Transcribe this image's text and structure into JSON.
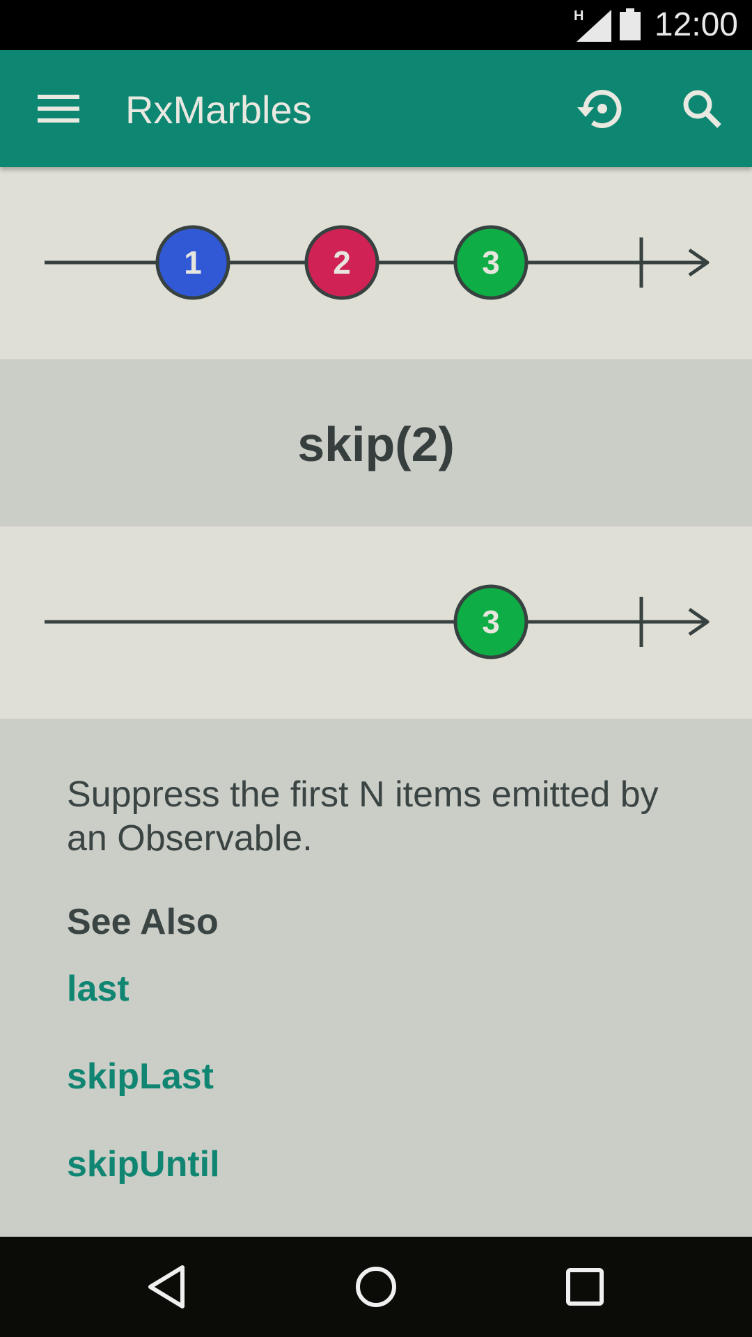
{
  "status_bar": {
    "time": "12:00",
    "network": "H"
  },
  "app_bar": {
    "title": "RxMarbles",
    "icons": {
      "menu": "menu-icon",
      "reset": "restore-icon",
      "search": "search-icon"
    }
  },
  "input_stream": {
    "marbles": [
      {
        "label": "1",
        "color": "#3159d6",
        "time": 1
      },
      {
        "label": "2",
        "color": "#d12255",
        "time": 2
      },
      {
        "label": "3",
        "color": "#0fad45",
        "time": 3
      }
    ],
    "completed": true
  },
  "operator": {
    "label": "skip(2)"
  },
  "output_stream": {
    "marbles": [
      {
        "label": "3",
        "color": "#0fad45",
        "time": 3
      }
    ],
    "completed": true
  },
  "description": {
    "text": "Suppress the first N items emitted by an Observable.",
    "see_also_heading": "See Also",
    "links": [
      "last",
      "skipLast",
      "skipUntil"
    ]
  },
  "colors": {
    "primary": "#0d8672",
    "link": "#108672",
    "lane_bg": "#dfdfd6",
    "content_bg": "#cbcdc7",
    "line": "#364140"
  }
}
